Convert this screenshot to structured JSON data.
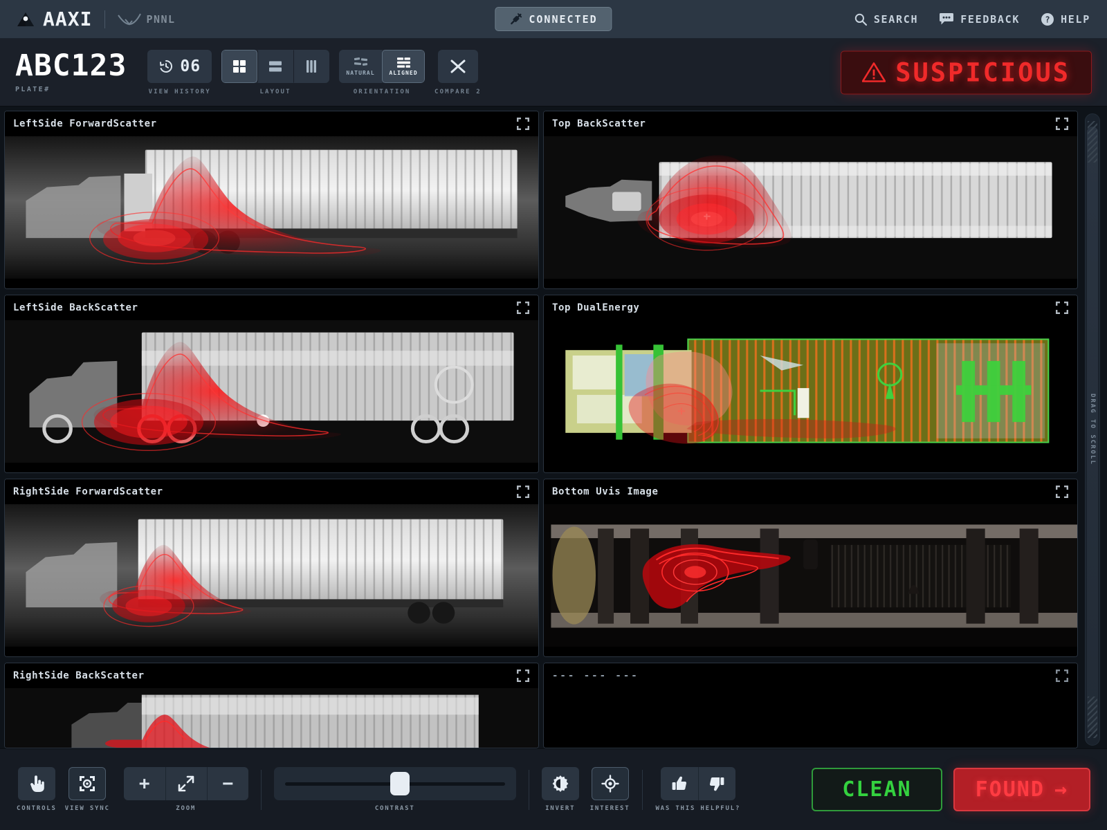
{
  "header": {
    "brand": "AAXI",
    "partner": "PNNL",
    "connection": {
      "label": "CONNECTED",
      "icon": "plug-icon"
    },
    "actions": [
      {
        "label": "SEARCH",
        "icon": "search-icon"
      },
      {
        "label": "FEEDBACK",
        "icon": "speech-bubble-icon"
      },
      {
        "label": "HELP",
        "icon": "question-circle-icon"
      }
    ]
  },
  "subbar": {
    "plate_value": "ABC123",
    "plate_caption": "PLATE#",
    "history": {
      "value": "06",
      "caption": "VIEW HISTORY",
      "icon": "history-clock-icon"
    },
    "layout": {
      "caption": "LAYOUT",
      "options": [
        {
          "name": "grid",
          "icon": "grid-2x2-icon",
          "active": true
        },
        {
          "name": "rows",
          "icon": "rows-icon",
          "active": false
        },
        {
          "name": "columns",
          "icon": "columns-icon",
          "active": false
        }
      ]
    },
    "orientation": {
      "caption": "ORIENTATION",
      "options": [
        {
          "label": "NATURAL",
          "icon": "natural-orientation-icon",
          "active": false
        },
        {
          "label": "ALIGNED",
          "icon": "aligned-orientation-icon",
          "active": true
        }
      ]
    },
    "compare": {
      "caption": "COMPARE 2",
      "icon": "shuffle-icon"
    },
    "status": {
      "label": "SUSPICIOUS",
      "icon": "warning-triangle-icon",
      "color": "#f02a2a"
    }
  },
  "panels": {
    "left": [
      {
        "title": "LeftSide ForwardScatter",
        "kind": "xray-grey"
      },
      {
        "title": "LeftSide BackScatter",
        "kind": "xray-grey"
      },
      {
        "title": "RightSide ForwardScatter",
        "kind": "xray-grey"
      },
      {
        "title": "RightSide BackScatter",
        "kind": "xray-grey"
      }
    ],
    "right": [
      {
        "title": "Top BackScatter",
        "kind": "xray-grey"
      },
      {
        "title": "Top DualEnergy",
        "kind": "dual-energy-color"
      },
      {
        "title": "Bottom Uvis Image",
        "kind": "uvis-photo"
      },
      {
        "title": "--- --- ---",
        "kind": "empty"
      }
    ],
    "expand_icon": "expand-corners-icon",
    "scrollbar_label": "DRAG TO SCROLL"
  },
  "bottombar": {
    "controls": {
      "caption": "CONTROLS",
      "icon": "hand-pointer-icon"
    },
    "view_sync": {
      "caption": "VIEW SYNC",
      "icon": "view-sync-icon",
      "active": true
    },
    "zoom": {
      "caption": "ZOOM",
      "buttons": [
        {
          "name": "zoom-in",
          "glyph": "+"
        },
        {
          "name": "zoom-fit",
          "glyph": "fit-arrows-icon"
        },
        {
          "name": "zoom-out",
          "glyph": "−"
        }
      ]
    },
    "contrast": {
      "caption": "CONTRAST",
      "value": 48
    },
    "invert": {
      "caption": "INVERT",
      "icon": "contrast-gear-icon"
    },
    "interest": {
      "caption": "INTEREST",
      "icon": "target-icon",
      "active": true
    },
    "helpful": {
      "caption": "WAS THIS HELPFUL?",
      "buttons": [
        {
          "name": "thumbs-up",
          "icon": "thumbs-up-icon"
        },
        {
          "name": "thumbs-down",
          "icon": "thumbs-down-icon"
        }
      ]
    },
    "clean_label": "CLEAN",
    "found_label": "FOUND",
    "found_arrow": "→"
  },
  "colors": {
    "accent_red": "#f02a2a",
    "accent_green": "#34d13f",
    "panel_bg": "#000000",
    "chrome": "#2c3744",
    "app_bg": "#0e1319"
  }
}
